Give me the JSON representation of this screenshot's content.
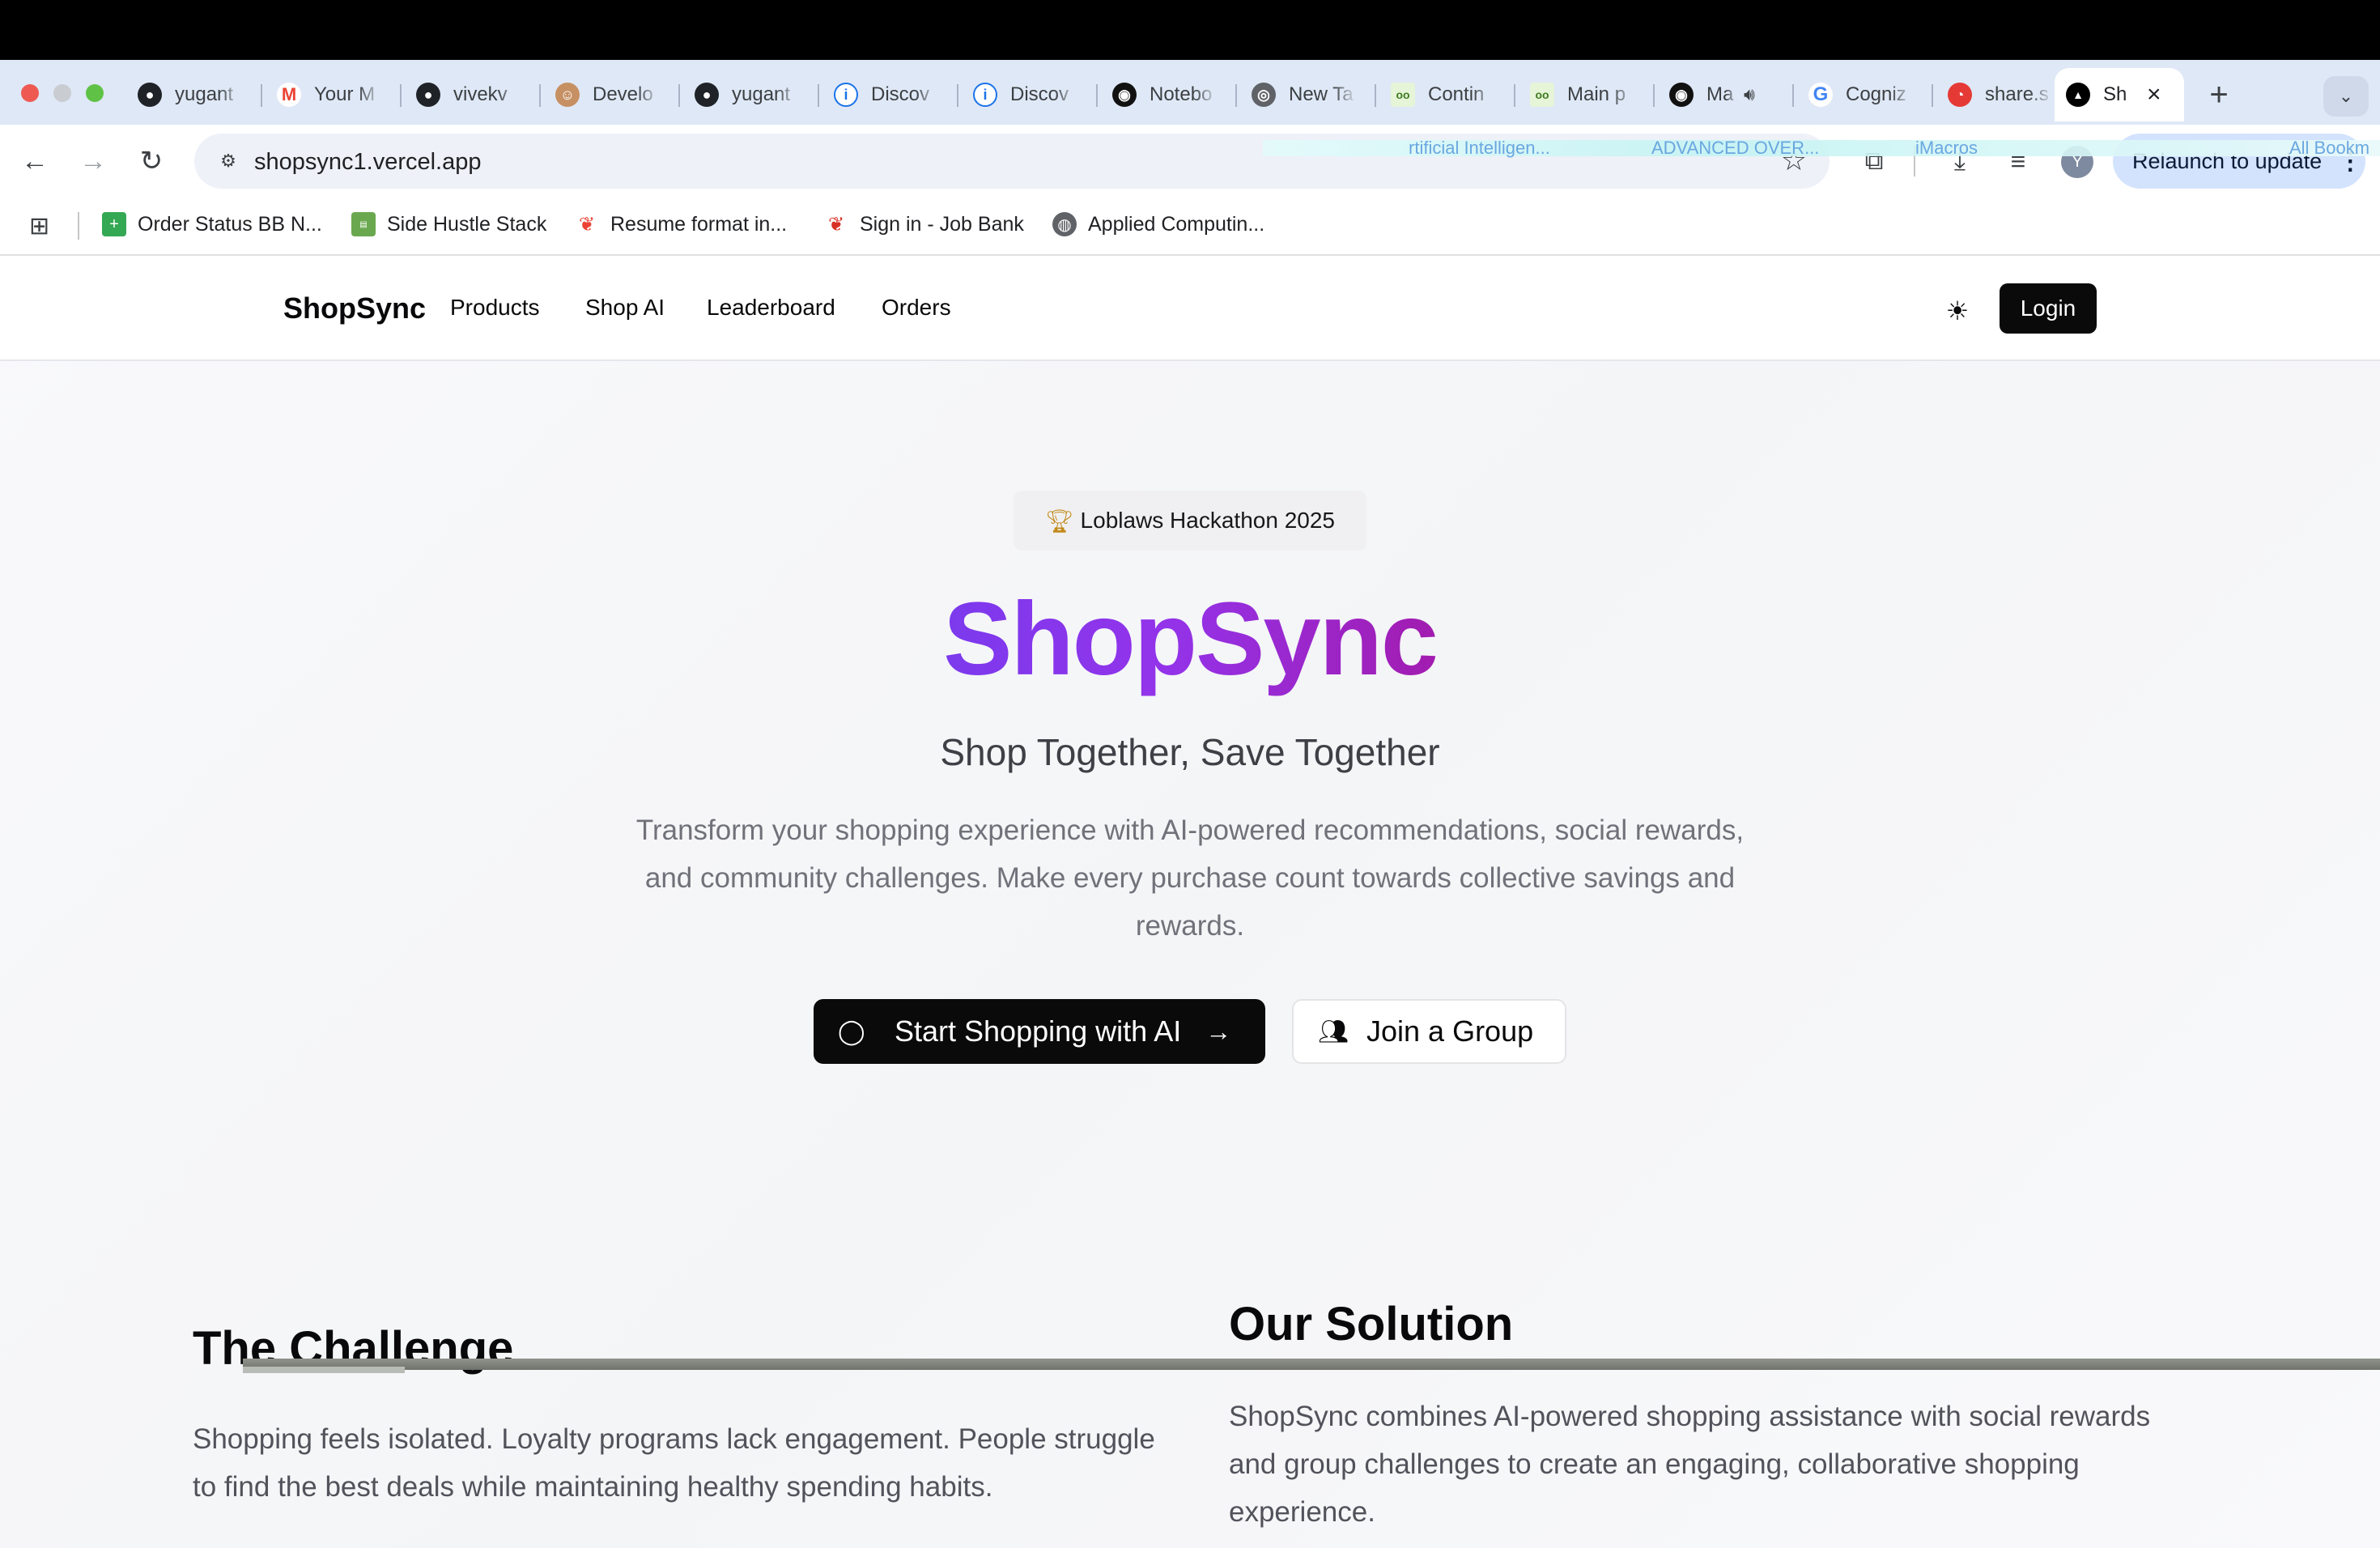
{
  "browser": {
    "tabs": [
      {
        "label": "yugant",
        "icon": "github-icon"
      },
      {
        "label": "Your M",
        "icon": "gmail-icon"
      },
      {
        "label": "vivekv",
        "icon": "github-icon"
      },
      {
        "label": "Develo",
        "icon": "avatar-icon"
      },
      {
        "label": "yugant",
        "icon": "github-icon"
      },
      {
        "label": "Discov",
        "icon": "info-icon"
      },
      {
        "label": "Discov",
        "icon": "info-icon"
      },
      {
        "label": "Notebo",
        "icon": "notebook-icon"
      },
      {
        "label": "New Ta",
        "icon": "chrome-icon"
      },
      {
        "label": "Contin",
        "icon": "app-icon"
      },
      {
        "label": "Main p",
        "icon": "app-icon"
      },
      {
        "label": "Ma",
        "icon": "notebook-icon"
      },
      {
        "label": "Cogniz",
        "icon": "google-icon"
      },
      {
        "label": "share.s",
        "icon": "share-icon"
      },
      {
        "label": "Sh",
        "icon": "vercel-icon",
        "active": true
      }
    ],
    "url": "shopsync1.vercel.app",
    "profile_initial": "Y",
    "relaunch_label": "Relaunch to update",
    "bookmarks": [
      {
        "label": "Order Status BB N...",
        "icon": "sheets-icon",
        "color": "#34a853"
      },
      {
        "label": "Side Hustle Stack",
        "icon": "doc-icon",
        "color": "#6aa84f"
      },
      {
        "label": "Resume format in...",
        "icon": "maple-leaf-icon",
        "color": "#ea4335"
      },
      {
        "label": "Sign in - Job Bank",
        "icon": "maple-leaf-icon",
        "color": "#d93025"
      },
      {
        "label": "Applied Computin...",
        "icon": "globe-icon",
        "color": "#5f6368"
      }
    ],
    "bookmarks_overflow": [
      "rtificial Intelligen...",
      "ADVANCED OVER...",
      "iMacros",
      "All Bookm"
    ]
  },
  "site": {
    "brand": "ShopSync",
    "nav": [
      "Products",
      "Shop AI",
      "Leaderboard",
      "Orders"
    ],
    "login_label": "Login",
    "badge": "Loblaws Hackathon 2025",
    "hero_title": "ShopSync",
    "hero_subtitle": "Shop Together, Save Together",
    "hero_description": "Transform your shopping experience with AI-powered recommendations, social rewards, and community challenges. Make every purchase count towards collective savings and rewards.",
    "cta_primary": "Start Shopping with AI",
    "cta_secondary": "Join a Group",
    "challenge": {
      "heading": "The Challenge",
      "text": "Shopping feels isolated. Loyalty programs lack engagement. People struggle to find the best deals while maintaining healthy spending habits."
    },
    "solution": {
      "heading": "Our Solution",
      "text": "ShopSync combines AI-powered shopping assistance with social rewards and group challenges to create an engaging, collaborative shopping experience."
    }
  },
  "colors": {
    "brand_gradient_start": "#7c3aed",
    "brand_gradient_end": "#a21caf",
    "primary_button": "#0a0a0a",
    "chrome_frame": "#dfe8f6"
  }
}
